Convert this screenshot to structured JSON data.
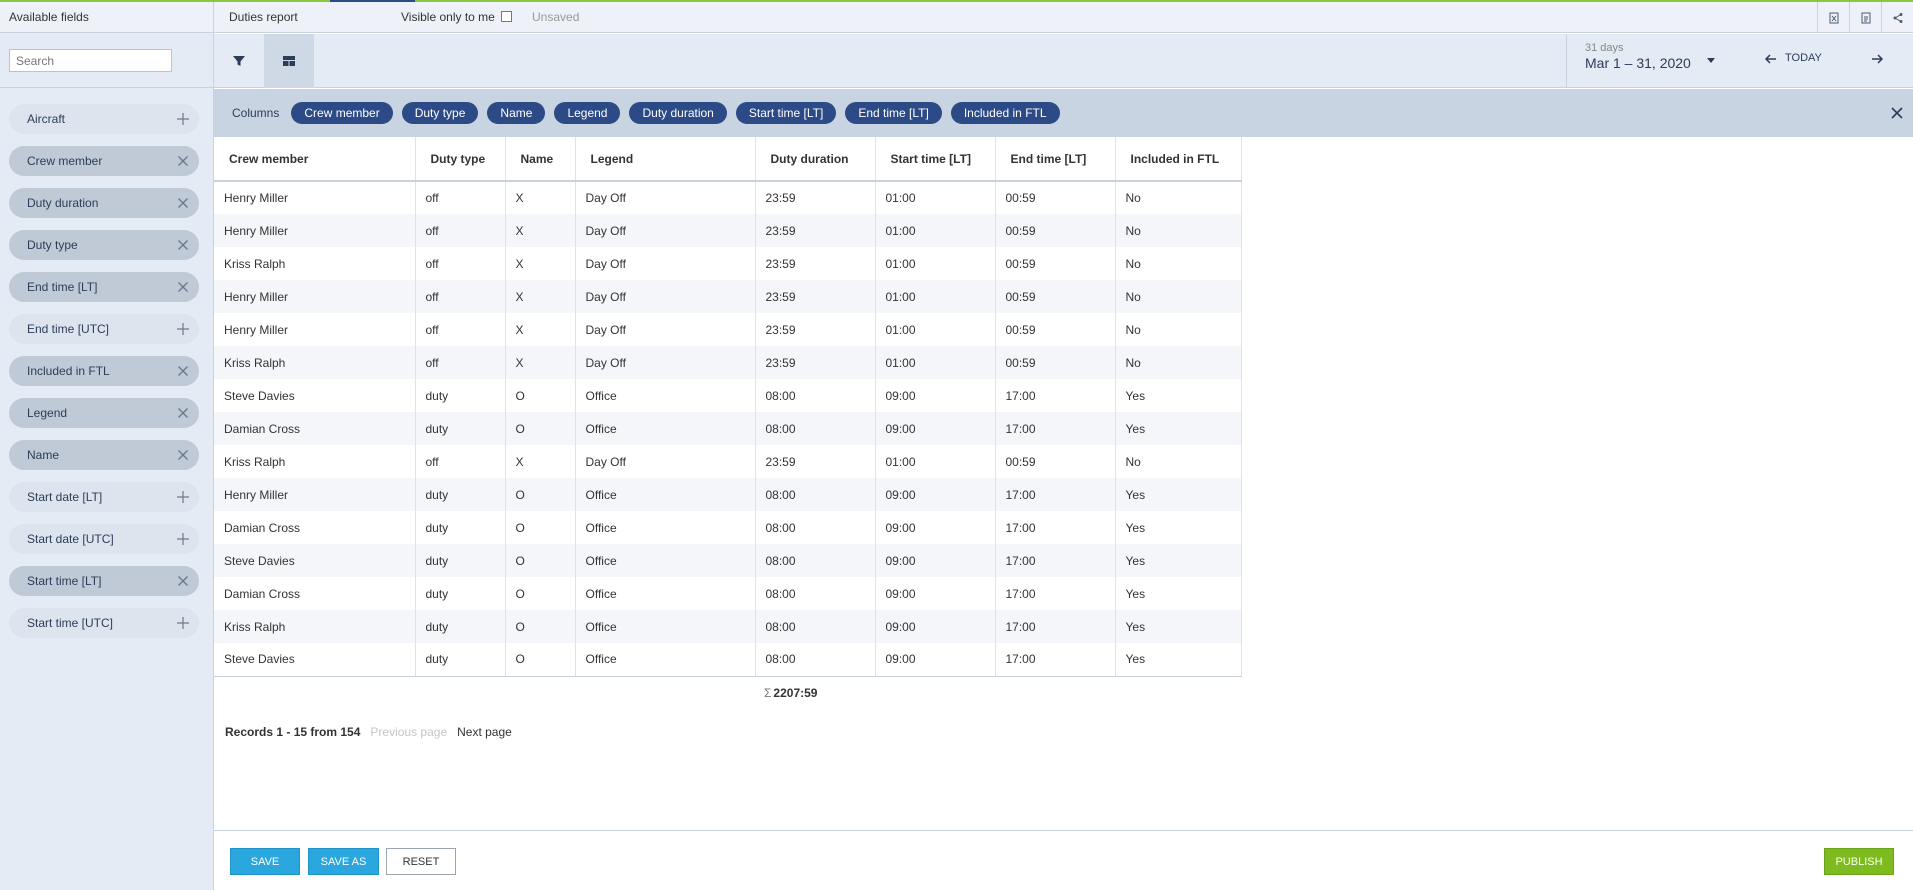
{
  "colors": {
    "accent_green": "#8cc63f",
    "chip_navy": "#2b4a86",
    "button_blue": "#2ba7df",
    "publish_green": "#7dbb1f"
  },
  "sidebar": {
    "title": "Available fields",
    "search_placeholder": "Search",
    "fields": [
      {
        "label": "Aircraft",
        "selected": false,
        "icon": "plus-icon"
      },
      {
        "label": "Crew member",
        "selected": true,
        "icon": "close-icon"
      },
      {
        "label": "Duty duration",
        "selected": true,
        "icon": "close-icon"
      },
      {
        "label": "Duty type",
        "selected": true,
        "icon": "close-icon"
      },
      {
        "label": "End time [LT]",
        "selected": true,
        "icon": "close-icon"
      },
      {
        "label": "End time [UTC]",
        "selected": false,
        "icon": "plus-icon"
      },
      {
        "label": "Included in FTL",
        "selected": true,
        "icon": "close-icon"
      },
      {
        "label": "Legend",
        "selected": true,
        "icon": "close-icon"
      },
      {
        "label": "Name",
        "selected": true,
        "icon": "close-icon"
      },
      {
        "label": "Start date [LT]",
        "selected": false,
        "icon": "plus-icon"
      },
      {
        "label": "Start date [UTC]",
        "selected": false,
        "icon": "plus-icon"
      },
      {
        "label": "Start time [LT]",
        "selected": true,
        "icon": "close-icon"
      },
      {
        "label": "Start time [UTC]",
        "selected": false,
        "icon": "plus-icon"
      }
    ]
  },
  "header": {
    "report_title": "Duties report",
    "visible_only_label": "Visible only to me",
    "visible_only_checked": false,
    "status": "Unsaved",
    "icons": [
      "export-excel-icon",
      "export-pdf-icon",
      "share-icon"
    ]
  },
  "toolbar": {
    "tools": [
      "filter-icon",
      "layout-icon"
    ],
    "days": "31 days",
    "date_range": "Mar 1 – 31, 2020",
    "today_label": "TODAY"
  },
  "columns_bar": {
    "label": "Columns",
    "chips": [
      "Crew member",
      "Duty type",
      "Name",
      "Legend",
      "Duty duration",
      "Start time [LT]",
      "End time [LT]",
      "Included in FTL"
    ]
  },
  "table": {
    "headers": [
      "Crew member",
      "Duty type",
      "Name",
      "Legend",
      "Duty duration",
      "Start time [LT]",
      "End time [LT]",
      "Included in FTL"
    ],
    "rows": [
      [
        "Henry Miller",
        "off",
        "X",
        "Day Off",
        "23:59",
        "01:00",
        "00:59",
        "No"
      ],
      [
        "Henry Miller",
        "off",
        "X",
        "Day Off",
        "23:59",
        "01:00",
        "00:59",
        "No"
      ],
      [
        "Kriss Ralph",
        "off",
        "X",
        "Day Off",
        "23:59",
        "01:00",
        "00:59",
        "No"
      ],
      [
        "Henry Miller",
        "off",
        "X",
        "Day Off",
        "23:59",
        "01:00",
        "00:59",
        "No"
      ],
      [
        "Henry Miller",
        "off",
        "X",
        "Day Off",
        "23:59",
        "01:00",
        "00:59",
        "No"
      ],
      [
        "Kriss Ralph",
        "off",
        "X",
        "Day Off",
        "23:59",
        "01:00",
        "00:59",
        "No"
      ],
      [
        "Steve Davies",
        "duty",
        "O",
        "Office",
        "08:00",
        "09:00",
        "17:00",
        "Yes"
      ],
      [
        "Damian Cross",
        "duty",
        "O",
        "Office",
        "08:00",
        "09:00",
        "17:00",
        "Yes"
      ],
      [
        "Kriss Ralph",
        "off",
        "X",
        "Day Off",
        "23:59",
        "01:00",
        "00:59",
        "No"
      ],
      [
        "Henry Miller",
        "duty",
        "O",
        "Office",
        "08:00",
        "09:00",
        "17:00",
        "Yes"
      ],
      [
        "Damian Cross",
        "duty",
        "O",
        "Office",
        "08:00",
        "09:00",
        "17:00",
        "Yes"
      ],
      [
        "Steve Davies",
        "duty",
        "O",
        "Office",
        "08:00",
        "09:00",
        "17:00",
        "Yes"
      ],
      [
        "Damian Cross",
        "duty",
        "O",
        "Office",
        "08:00",
        "09:00",
        "17:00",
        "Yes"
      ],
      [
        "Kriss Ralph",
        "duty",
        "O",
        "Office",
        "08:00",
        "09:00",
        "17:00",
        "Yes"
      ],
      [
        "Steve Davies",
        "duty",
        "O",
        "Office",
        "08:00",
        "09:00",
        "17:00",
        "Yes"
      ]
    ],
    "sum_symbol": "Σ",
    "sum_value": "2207:59",
    "records_label": "Records 1 - 15 from 154",
    "prev_label": "Previous page",
    "next_label": "Next page"
  },
  "footer": {
    "save_label": "SAVE",
    "save_as_label": "SAVE AS",
    "reset_label": "RESET",
    "publish_label": "PUBLISH"
  }
}
